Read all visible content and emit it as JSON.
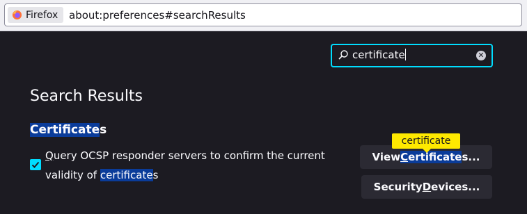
{
  "browser": {
    "identity_label": "Firefox",
    "url": "about:preferences#searchResults"
  },
  "search": {
    "value": "certificate"
  },
  "page": {
    "title": "Search Results"
  },
  "section": {
    "title_match": "Certificate",
    "title_rest": "s"
  },
  "ocsp": {
    "checked": true,
    "label_accesskey": "Q",
    "label_part1": "uery OCSP responder servers to confirm the current validity of ",
    "label_match": "certificate",
    "label_part2": "s"
  },
  "tooltip": {
    "text": "certificate"
  },
  "buttons": {
    "view_pre": "View ",
    "view_accesskey": "C",
    "view_match_rest": "ertificate",
    "view_post": "s...",
    "security_pre": "Security ",
    "security_accesskey": "D",
    "security_post": "evices..."
  },
  "colors": {
    "background": "#1c1b22",
    "accent": "#00ddff",
    "highlight": "#0a3c9a",
    "tooltip": "#ffe900"
  }
}
